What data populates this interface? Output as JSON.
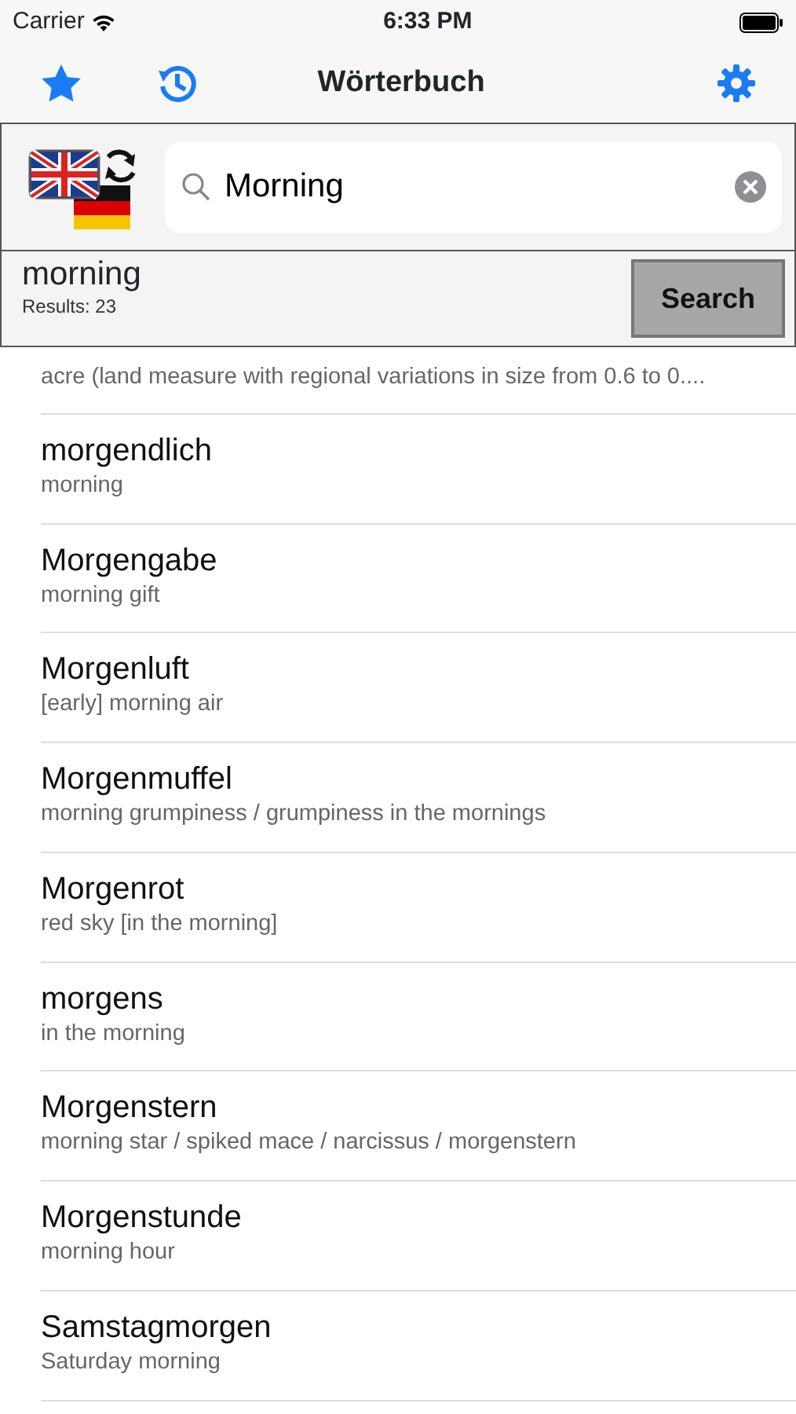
{
  "status_bar": {
    "carrier": "Carrier",
    "time": "6:33 PM"
  },
  "nav": {
    "title": "Wörterbuch"
  },
  "search": {
    "value": "Morning"
  },
  "result_bar": {
    "query": "morning",
    "count": "Results: 23",
    "button": "Search"
  },
  "rows": [
    {
      "translation": "acre (land measure with regional variations in size from 0.6 to 0...."
    },
    {
      "word": "morgendlich",
      "translation": "morning"
    },
    {
      "word": "Morgengabe",
      "translation": "morning gift"
    },
    {
      "word": "Morgenluft",
      "translation": "[early] morning air"
    },
    {
      "word": "Morgenmuffel",
      "translation": "morning grumpiness / grumpiness in the mornings"
    },
    {
      "word": "Morgenrot",
      "translation": "red sky [in the morning]"
    },
    {
      "word": "morgens",
      "translation": "in the morning"
    },
    {
      "word": "Morgenstern",
      "translation": "morning star / spiked mace / narcissus / morgenstern"
    },
    {
      "word": "Morgenstunde",
      "translation": "morning hour"
    },
    {
      "word": "Samstagmorgen",
      "translation": "Saturday morning"
    }
  ]
}
